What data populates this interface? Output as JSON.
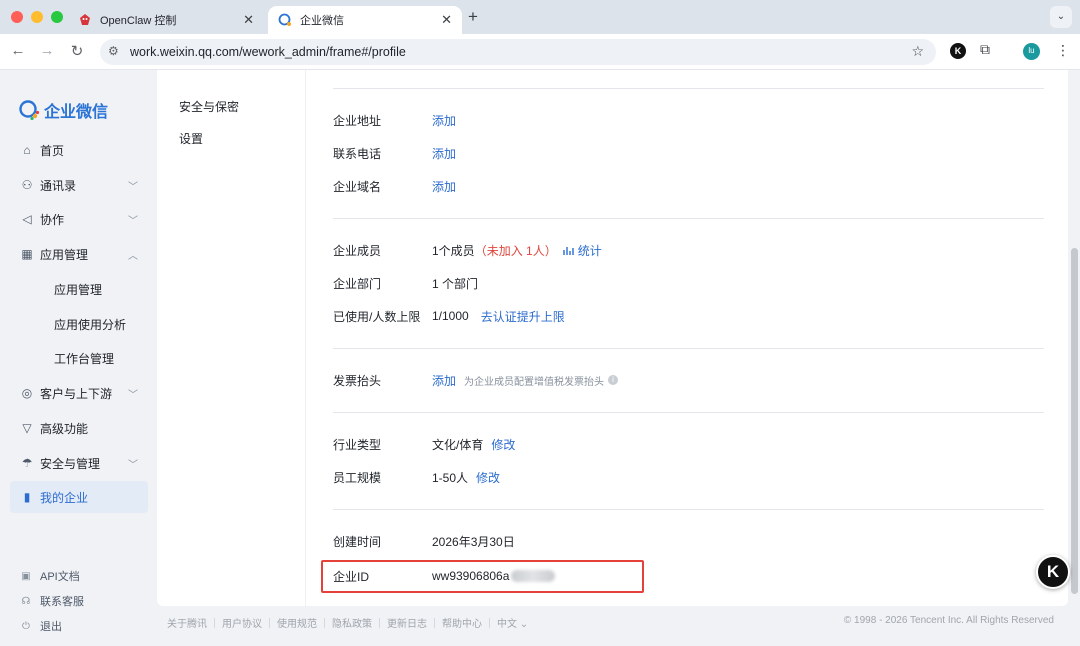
{
  "browser": {
    "tabs": [
      {
        "title": "OpenClaw 控制",
        "close": "✕",
        "icon": "openclaw-icon"
      },
      {
        "title": "企业微信",
        "close": "✕",
        "icon": "wecom-icon"
      }
    ],
    "new_tab": "+",
    "tab_menu": "⌄",
    "url": "work.weixin.qq.com/wework_admin/frame#/profile",
    "star": "☆",
    "ext_k": "K",
    "avatar": "lu",
    "more": "⋮"
  },
  "sidebar": {
    "logo_text": "企业微信",
    "items": [
      {
        "label": "首页",
        "icon": "home-icon",
        "glyph": "⌂",
        "chev": ""
      },
      {
        "label": "通讯录",
        "icon": "contacts-icon",
        "glyph": "⚇",
        "chev": "﹀"
      },
      {
        "label": "协作",
        "icon": "collab-icon",
        "glyph": "◁",
        "chev": "﹀"
      },
      {
        "label": "应用管理",
        "icon": "apps-icon",
        "glyph": "▦",
        "chev": "︿"
      },
      {
        "label": "应用管理",
        "icon": "",
        "glyph": "",
        "chev": ""
      },
      {
        "label": "应用使用分析",
        "icon": "",
        "glyph": "",
        "chev": ""
      },
      {
        "label": "工作台管理",
        "icon": "",
        "glyph": "",
        "chev": ""
      },
      {
        "label": "客户与上下游",
        "icon": "customer-icon",
        "glyph": "◎",
        "chev": "﹀"
      },
      {
        "label": "高级功能",
        "icon": "advanced-icon",
        "glyph": "▽",
        "chev": ""
      },
      {
        "label": "安全与管理",
        "icon": "security-icon",
        "glyph": "☂",
        "chev": "﹀"
      },
      {
        "label": "我的企业",
        "icon": "enterprise-icon",
        "glyph": "▮",
        "chev": ""
      }
    ],
    "bottom": [
      {
        "label": "API文档",
        "icon": "api-doc-icon",
        "glyph": "▣"
      },
      {
        "label": "联系客服",
        "icon": "support-icon",
        "glyph": "☊"
      },
      {
        "label": "退出",
        "icon": "logout-icon",
        "glyph": "⏻"
      }
    ]
  },
  "subnav": {
    "items": [
      "安全与保密",
      "设置"
    ]
  },
  "profile": {
    "address": {
      "label": "企业地址",
      "action": "添加"
    },
    "phone": {
      "label": "联系电话",
      "action": "添加"
    },
    "domain": {
      "label": "企业域名",
      "action": "添加"
    },
    "members": {
      "label": "企业成员",
      "value": "1个成员",
      "pending": "（未加入 1人）",
      "stats_icon": "chart-icon",
      "stats": "统计"
    },
    "departments": {
      "label": "企业部门",
      "value": "1 个部门"
    },
    "limit": {
      "label": "已使用/人数上限",
      "value": "1/1000",
      "action": "去认证提升上限"
    },
    "invoice": {
      "label": "发票抬头",
      "action": "添加",
      "hint": "为企业成员配置增值税发票抬头",
      "info": "i"
    },
    "industry": {
      "label": "行业类型",
      "value": "文化/体育",
      "action": "修改"
    },
    "scale": {
      "label": "员工规模",
      "value": "1-50人",
      "action": "修改"
    },
    "created": {
      "label": "创建时间",
      "value": "2026年3月30日"
    },
    "corp_id": {
      "label": "企业ID",
      "value": "ww93906806a"
    }
  },
  "floating": {
    "k": "K"
  },
  "footer": {
    "links": [
      "关于腾讯",
      "用户协议",
      "使用规范",
      "隐私政策",
      "更新日志",
      "帮助中心",
      "中文 ⌄"
    ],
    "copyright": "© 1998 - 2026 Tencent Inc. All Rights Reserved"
  },
  "colors": {
    "accent": "#2b6ccf",
    "warn": "#e0463d",
    "highlight": "#e5413b"
  }
}
